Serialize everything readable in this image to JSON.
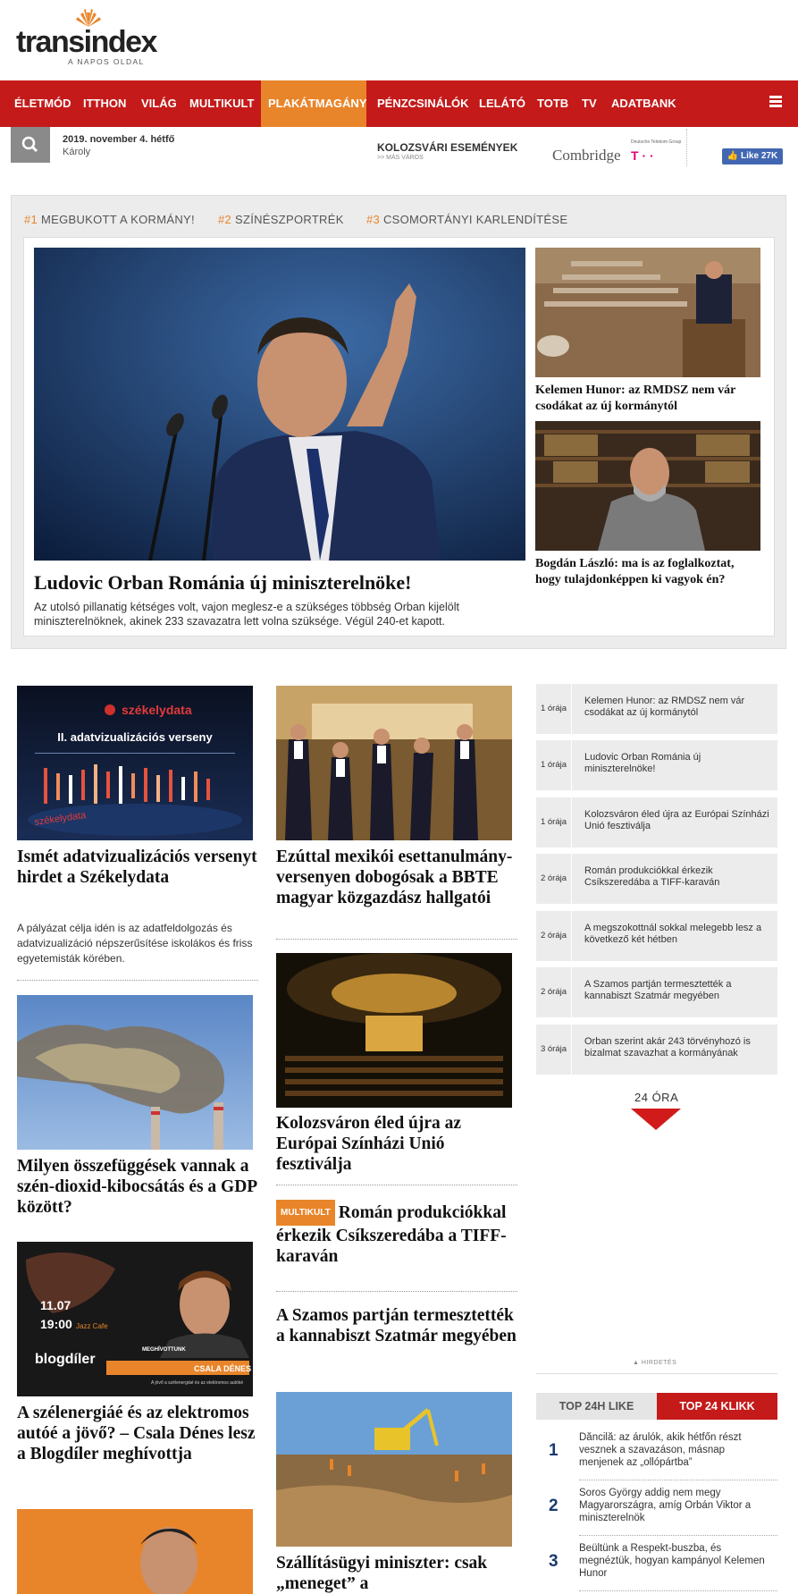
{
  "logo": {
    "name": "transindex",
    "tagline": "A NAPOS OLDAL"
  },
  "nav": {
    "items": [
      "ÉLETMÓD",
      "ITTHON",
      "VILÁG",
      "MULTIKULT",
      "PLAKÁTMAGÁNY",
      "PÉNZCSINÁLÓK",
      "LELÁTÓ",
      "TOTB",
      "TV",
      "ADATBANK"
    ],
    "active": "PLAKÁTMAGÁNY"
  },
  "subbar": {
    "date": "2019. november 4. hétfő",
    "nameday": "Károly",
    "events_title": "KOLOZSVÁRI ESEMÉNYEK",
    "events_sub": ">> MÁS VÁROS",
    "sponsor": "Combridge",
    "sponsor_group": "Deutsche Telekom Group",
    "sponsor_mark": "T · ·",
    "fb_like": "Like 27K"
  },
  "trending": [
    {
      "num": "#1",
      "label": "MEGBUKOTT A KORMÁNY!"
    },
    {
      "num": "#2",
      "label": "SZÍNÉSZPORTRÉK"
    },
    {
      "num": "#3",
      "label": "CSOMORTÁNYI KARLENDÍTÉSE"
    }
  ],
  "hero": {
    "title": "Ludovic Orban Románia új miniszterelnöke!",
    "lede": "Az utolsó pillanatig kétséges volt, vajon meglesz-e a szükséges többség Orban kijelölt miniszterelnöknek, akinek 233 szavazatra lett volna szüksége. Végül 240-et kapott."
  },
  "side_stories": [
    {
      "title": "Kelemen Hunor: az RMDSZ nem vár csodákat az új kormánytól"
    },
    {
      "title": "Bogdán László: ma is az foglalkoztat, hogy tulajdonképpen ki vagyok én?"
    }
  ],
  "col1": [
    {
      "title": "Ismét adatvizualizációs versenyt hirdet a Székelydata",
      "lede": "A pályázat célja idén is az adatfeldolgozás és adatvizualizáció népszerűsítése iskolákos és friss egyetemisták körében.",
      "img_brand": "székelydata",
      "img_caption": "II. adatvizualizációs verseny",
      "img_watermark": "székelydata"
    },
    {
      "title": "Milyen összefüggések vannak a szén-dioxid-kibocsátás és a GDP között?"
    },
    {
      "title": "A szélenergiáé és az elektromos autóé a jövő? – Csala Dénes lesz a Blogdíler meghívottja",
      "img_date": "11.07",
      "img_time": "19:00",
      "img_venue": "Jazz Cafe",
      "img_brand": "blogdíler",
      "img_guest_label": "MEGHÍVOTTUNK",
      "img_guest": "CSALA DÉNES",
      "img_topic": "A jövő a szélenergiáé és az elektromos autóké"
    }
  ],
  "col2": [
    {
      "title": "Ezúttal mexikói esettanulmány-versenyen dobogósak a BBTE magyar közgazdász hallgatói"
    },
    {
      "title": "Kolozsváron éled újra az Európai Színházi Unió fesztiválja"
    },
    {
      "badge": "MULTIKULT",
      "title": "Román produkciókkal érkezik Csíkszeredába a TIFF-karaván"
    },
    {
      "title": "A Szamos partján termesztették a kannabiszt Szatmár megyében"
    },
    {
      "title": "Szállításügyi miniszter: csak „meneget” a"
    }
  ],
  "latest": [
    {
      "ago": "1 órája",
      "title": "Kelemen Hunor: az RMDSZ nem vár csodákat az új kormánytól"
    },
    {
      "ago": "1 órája",
      "title": "Ludovic Orban Románia új miniszterelnöke!"
    },
    {
      "ago": "1 órája",
      "title": "Kolozsváron éled újra az Európai Színházi Unió fesztiválja"
    },
    {
      "ago": "2 órája",
      "title": "Román produkciókkal érkezik Csíkszeredába a TIFF-karaván"
    },
    {
      "ago": "2 órája",
      "title": "A megszokottnál sokkal melegebb lesz a következő két hétben"
    },
    {
      "ago": "2 órája",
      "title": "A Szamos partján termesztették a kannabiszt Szatmár megyében"
    },
    {
      "ago": "3 órája",
      "title": "Orban szerint akár 243 törvényhozó is bizalmat szavazhat a kormányának"
    }
  ],
  "more_label": "24 ÓRA",
  "ad_label": "HIRDETÉS",
  "top_tabs": {
    "like": "TOP 24H LIKE",
    "click": "TOP 24 KLIKK"
  },
  "top_list": [
    {
      "n": "1",
      "title": "Dăncilă: az árulók, akik hétfőn részt vesznek a szavazáson, másnap menjenek az „ollópártba”"
    },
    {
      "n": "2",
      "title": "Soros György addig nem megy Magyarországra, amíg Orbán Viktor a miniszterelnök"
    },
    {
      "n": "3",
      "title": "Beültünk a Respekt-buszba, és megnéztük, hogyan kampányol Kelemen Hunor"
    }
  ],
  "colors": {
    "nav_red": "#c41a1a",
    "accent_orange": "#e8852a",
    "rank_blue": "#1a3a6e"
  }
}
